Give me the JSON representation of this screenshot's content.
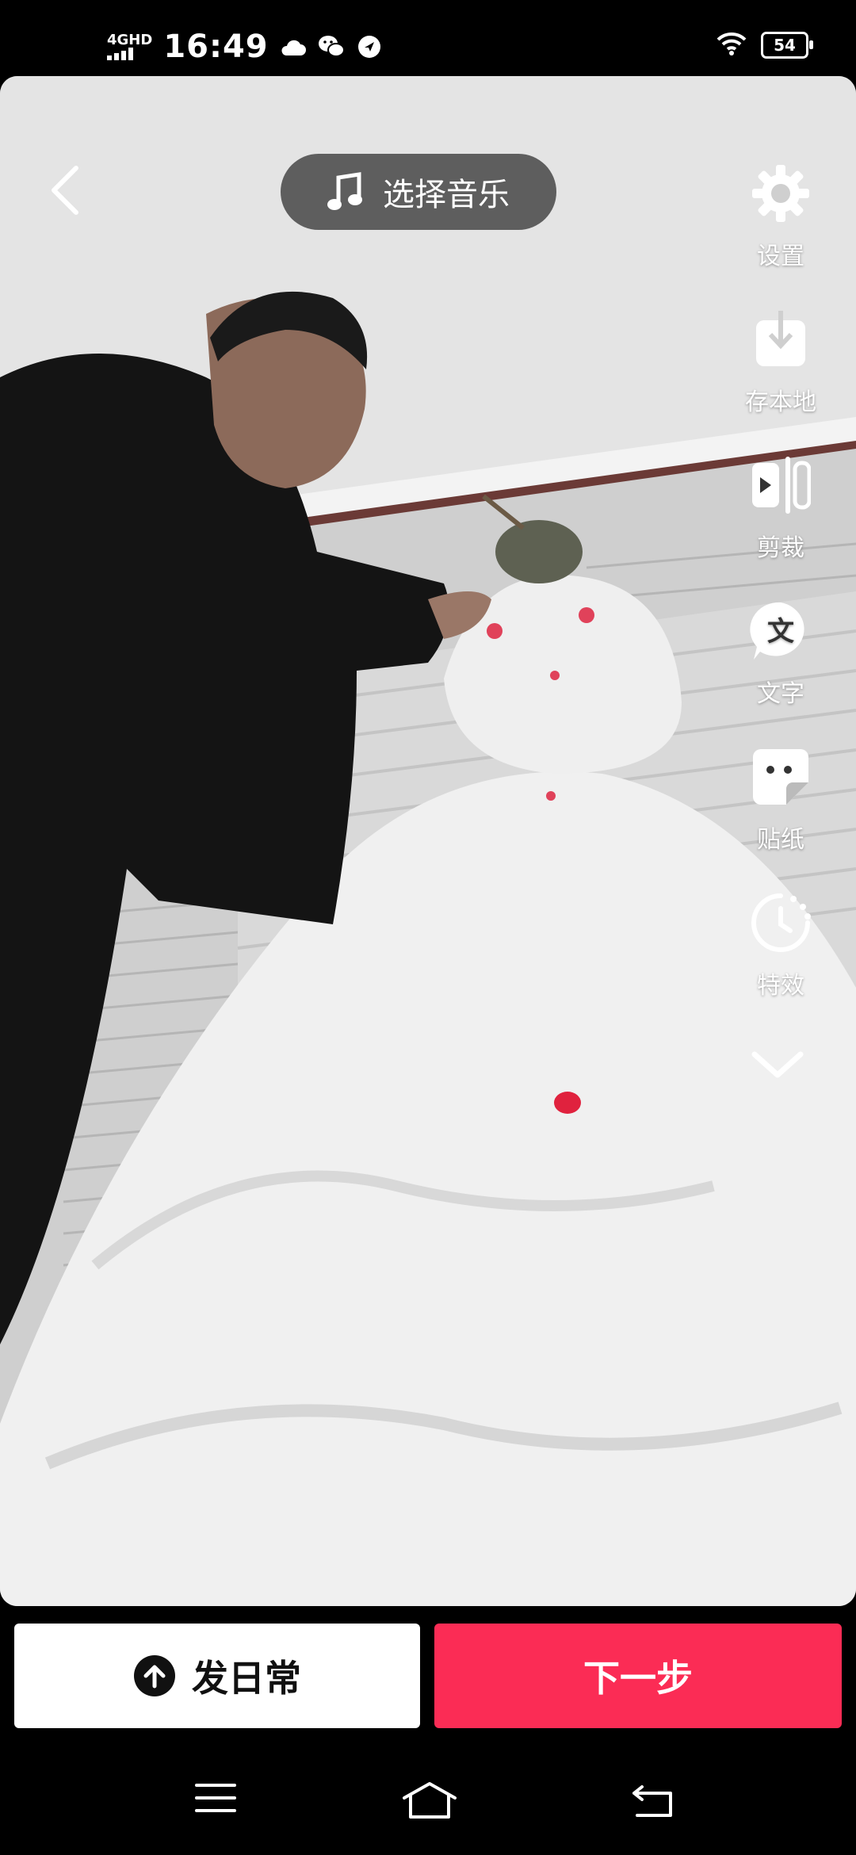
{
  "status_bar": {
    "network": "4GHD",
    "time": "16:49",
    "battery": "54"
  },
  "editor": {
    "music_label": "选择音乐",
    "tools": [
      {
        "label": "设置",
        "icon": "gear-icon"
      },
      {
        "label": "存本地",
        "icon": "download-icon"
      },
      {
        "label": "剪裁",
        "icon": "cut-icon"
      },
      {
        "label": "文字",
        "icon": "text-icon"
      },
      {
        "label": "贴纸",
        "icon": "sticker-icon"
      },
      {
        "label": "特效",
        "icon": "effects-icon"
      }
    ]
  },
  "actions": {
    "daily_label": "发日常",
    "next_label": "下一步"
  },
  "colors": {
    "accent": "#fb2c55"
  }
}
